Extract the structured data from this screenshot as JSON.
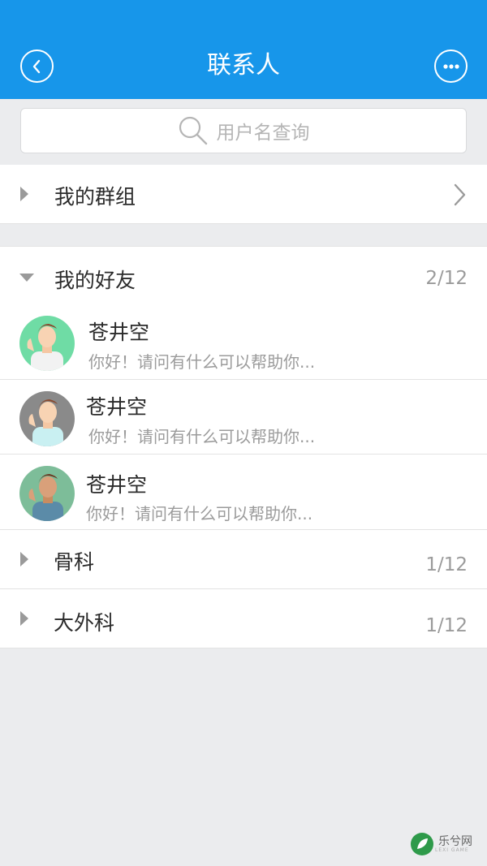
{
  "header": {
    "title": "联系人",
    "background_color": "#1796ea",
    "back_icon": "chevron-left-icon",
    "more_icon": "more-dots-icon"
  },
  "search": {
    "placeholder": "用户名查询",
    "icon": "search-icon"
  },
  "groups_row": {
    "label": "我的群组"
  },
  "friends": {
    "label": "我的好友",
    "count": "2/12",
    "contacts": [
      {
        "name": "苍井空",
        "message": "你好！请问有什么可以帮助你...",
        "avatar_bg": "#6fdca5"
      },
      {
        "name": "苍井空",
        "message": "你好！请问有什么可以帮助你...",
        "avatar_bg": "#8a8a8a"
      },
      {
        "name": "苍井空",
        "message": "你好！请问有什么可以帮助你...",
        "avatar_bg": "#7dbd99"
      }
    ]
  },
  "other_groups": [
    {
      "label": "骨科",
      "count": "1/12"
    },
    {
      "label": "大外科",
      "count": "1/12"
    }
  ],
  "watermark": {
    "text": "乐兮网",
    "sub": "LEXI GAME"
  }
}
